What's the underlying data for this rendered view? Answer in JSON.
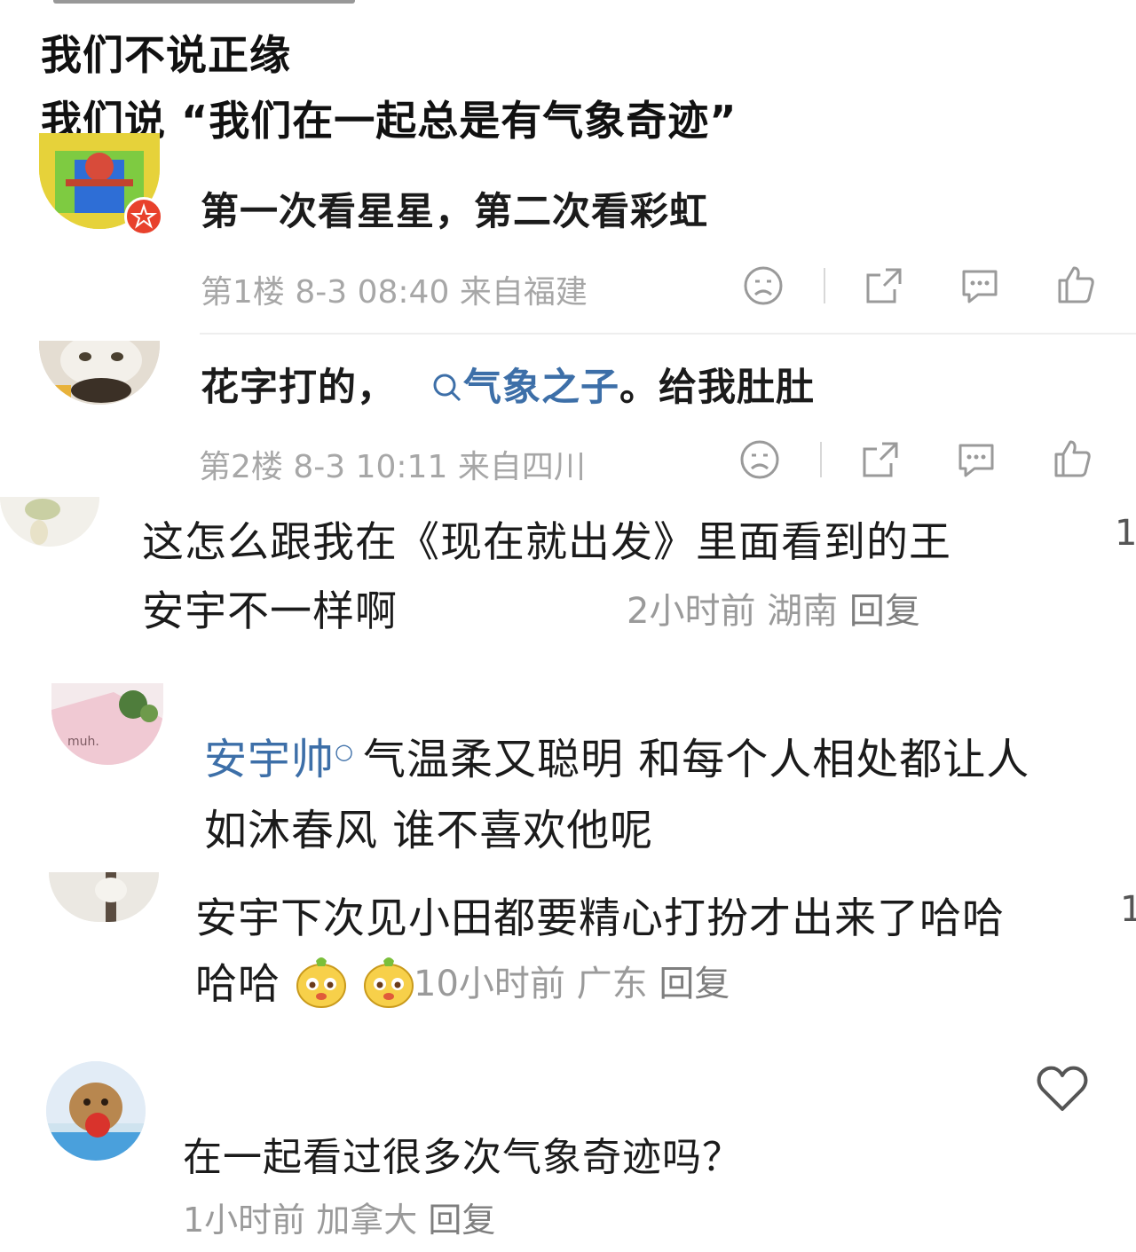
{
  "post": {
    "lines": [
      "我们不说正缘",
      "我们说 “我们在一起总是有气象奇迹”"
    ]
  },
  "weibo_comments": [
    {
      "text": "第一次看星星，第二次看彩虹",
      "floor": "第1楼",
      "date": "8-3 08:40",
      "location": "来自福建"
    },
    {
      "text_prefix": "花字打的，",
      "link": "气象之子",
      "text_suffix": "。给我肚肚",
      "floor": "第2楼",
      "date": "8-3 10:11",
      "location": "来自四川"
    }
  ],
  "xhs_comments": [
    {
      "line1": "这怎么跟我在《现在就出发》里面看到的王",
      "line2": "安宇不一样啊",
      "time": "2小时前",
      "location": "湖南",
      "reply": "回复",
      "side": "1"
    },
    {
      "mention": "安宇帅",
      "line1": "气温柔又聪明 和每个人相处都让人",
      "line2": "如沐春风 谁不喜欢他呢"
    },
    {
      "line1": "安宇下次见小田都要精心打扮才出来了哈哈",
      "line2": "哈哈",
      "time": "10小时前",
      "location": "广东",
      "reply": "回复",
      "side": "1"
    },
    {
      "text": "在一起看过很多次气象奇迹吗？",
      "time": "1小时前",
      "location": "加拿大",
      "reply": "回复"
    }
  ],
  "icons": [
    "sad-face-icon",
    "share-icon",
    "comment-icon",
    "like-thumb-icon",
    "search-icon",
    "heart-icon",
    "emoji-face-icon",
    "vip-badge-icon"
  ],
  "colors": {
    "link": "#3d6fa8",
    "meta": "#a7a7a7",
    "badge": "#e8412c"
  }
}
